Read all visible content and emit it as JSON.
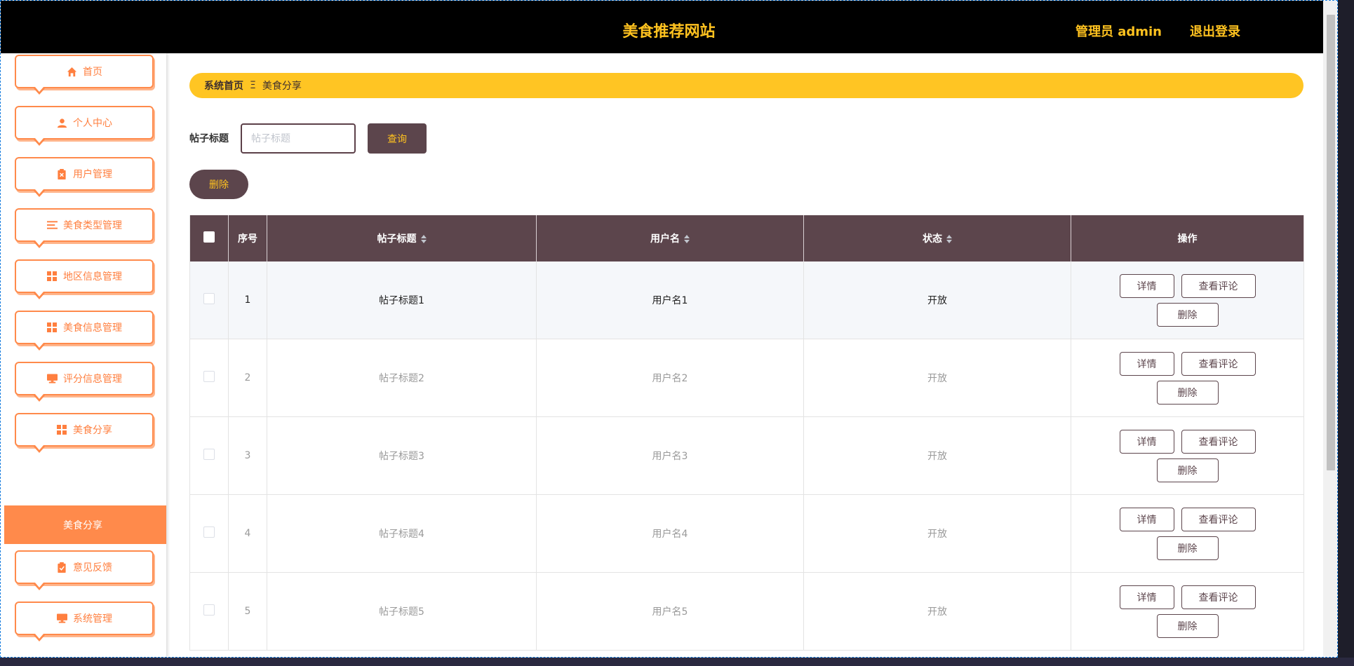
{
  "header": {
    "site_title": "美食推荐网站",
    "admin_label": "管理员 admin",
    "logout_label": "退出登录"
  },
  "sidebar": {
    "items": [
      {
        "label": "首页",
        "icon": "home-icon"
      },
      {
        "label": "个人中心",
        "icon": "user-icon"
      },
      {
        "label": "用户管理",
        "icon": "clipboard-x-icon"
      },
      {
        "label": "美食类型管理",
        "icon": "list-icon"
      },
      {
        "label": "地区信息管理",
        "icon": "grid-icon"
      },
      {
        "label": "美食信息管理",
        "icon": "grid-icon"
      },
      {
        "label": "评分信息管理",
        "icon": "monitor-icon"
      },
      {
        "label": "美食分享",
        "icon": "grid-icon"
      },
      {
        "label": "意见反馈",
        "icon": "clipboard-check-icon"
      },
      {
        "label": "系统管理",
        "icon": "monitor-icon"
      }
    ],
    "active_sub_label": "美食分享"
  },
  "breadcrumb": {
    "home": "系统首页",
    "separator": "Ξ",
    "current": "美食分享"
  },
  "search": {
    "label": "帖子标题",
    "placeholder": "帖子标题",
    "value": "",
    "query_label": "查询"
  },
  "bulk": {
    "delete_label": "删除"
  },
  "table": {
    "headers": {
      "index": "序号",
      "title": "帖子标题",
      "username": "用户名",
      "status": "状态",
      "actions": "操作"
    },
    "rows": [
      {
        "index": "1",
        "title": "帖子标题1",
        "username": "用户名1",
        "status": "开放"
      },
      {
        "index": "2",
        "title": "帖子标题2",
        "username": "用户名2",
        "status": "开放"
      },
      {
        "index": "3",
        "title": "帖子标题3",
        "username": "用户名3",
        "status": "开放"
      },
      {
        "index": "4",
        "title": "帖子标题4",
        "username": "用户名4",
        "status": "开放"
      },
      {
        "index": "5",
        "title": "帖子标题5",
        "username": "用户名5",
        "status": "开放"
      }
    ],
    "actions": {
      "detail": "详情",
      "comments": "查看评论",
      "delete": "删除"
    }
  },
  "colors": {
    "accent": "#ffc21f",
    "orange": "#ff8a4b",
    "header_bg": "#5c454c",
    "topbar": "#000000"
  }
}
